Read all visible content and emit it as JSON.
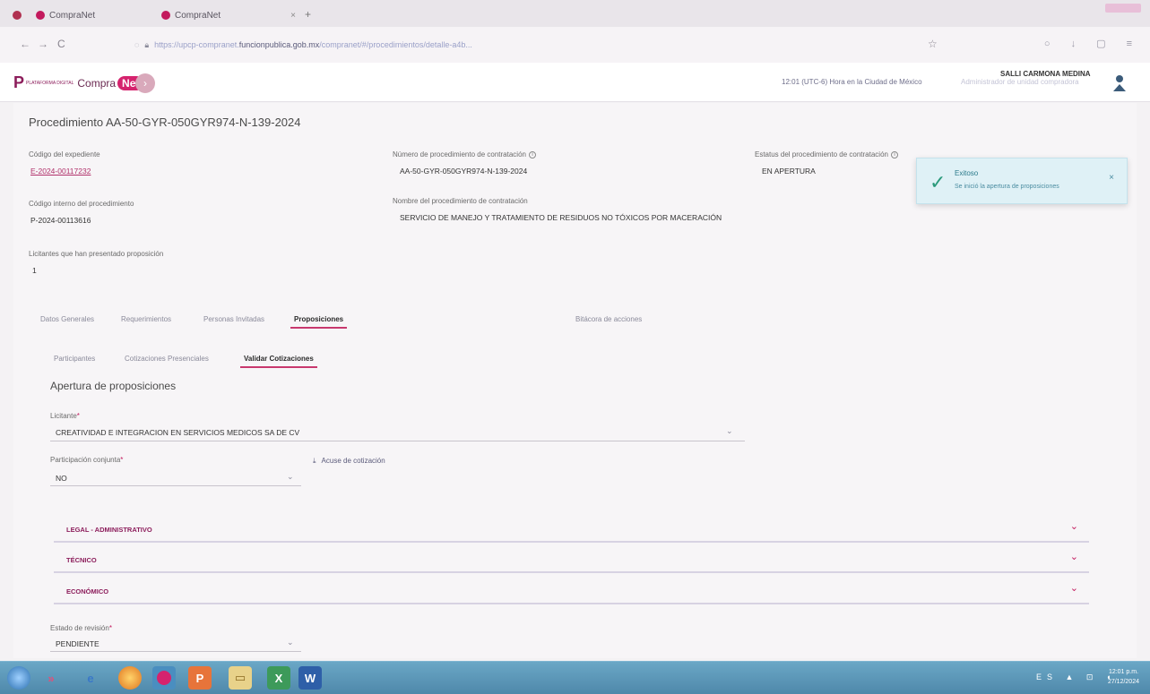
{
  "browser": {
    "tabs": [
      {
        "label": "CompraNet",
        "close": "×"
      },
      {
        "label": "CompraNet",
        "close": "×"
      }
    ],
    "new_tab": "+",
    "nav": {
      "back": "←",
      "forward": "→",
      "reload": "C"
    },
    "url_prefix": "https://upcp-compranet.",
    "url_host": "funcionpublica.gob.mx",
    "url_suffix": "/compranet/#/procedimientos/detalle-a4b..."
  },
  "app_header": {
    "logo_prefix": "P",
    "logo_small": "PLATAFORMA DIGITAL",
    "logo_text": "Compra",
    "logo_net": "Net",
    "menu_glyph": "›",
    "clock": "12:01 (UTC-6) Hora en la Ciudad de México",
    "role_hint": "Administrador de unidad compradora",
    "user_name": "SALLI CARMONA MEDINA"
  },
  "procedure": {
    "title": "Procedimiento AA-50-GYR-050GYR974-N-139-2024",
    "fields": {
      "codigo_expediente_label": "Código del expediente",
      "codigo_expediente_value": "E-2024-00117232",
      "numero_proc_label": "Número de procedimiento de contratación",
      "numero_proc_value": "AA-50-GYR-050GYR974-N-139-2024",
      "estatus_label": "Estatus del procedimiento de contratación",
      "estatus_value": "EN APERTURA",
      "codigo_interno_label": "Código interno del procedimiento",
      "codigo_interno_value": "P-2024-00113616",
      "nombre_proc_label": "Nombre del procedimiento de contratación",
      "nombre_proc_value": "SERVICIO DE MANEJO Y TRATAMIENTO DE RESIDUOS NO TÓXICOS POR MACERACIÓN",
      "licitantes_label": "Licitantes que han presentado proposición",
      "licitantes_value": "1"
    }
  },
  "toast": {
    "title": "Exitoso",
    "message": "Se inició la apertura de proposiciones",
    "close": "×"
  },
  "tabs": [
    "Datos Generales",
    "Requerimientos",
    "Personas Invitadas",
    "Proposiciones",
    "Bitácora de acciones"
  ],
  "active_tab": "Proposiciones",
  "subtabs": [
    "Participantes",
    "Cotizaciones Presenciales",
    "Validar Cotizaciones"
  ],
  "active_subtab": "Validar Cotizaciones",
  "apertura": {
    "title": "Apertura de proposiciones",
    "licitante_label": "Licitante",
    "licitante_value": "CREATIVIDAD E INTEGRACION EN SERVICIOS MEDICOS SA DE CV",
    "participacion_label": "Participación conjunta",
    "participacion_value": "NO",
    "acuse_label": "Acuse de cotización",
    "sections": [
      "LEGAL - ADMINISTRATIVO",
      "TÉCNICO",
      "ECONÓMICO"
    ],
    "estado_label": "Estado de revisión",
    "estado_value": "PENDIENTE",
    "required_mark": "*"
  },
  "taskbar": {
    "time": "12:01 p.m.",
    "date": "27/12/2024",
    "tray": "ES ▲ ⊡ ◖"
  },
  "colors": {
    "brand": "#c3195d",
    "toast_bg": "#dff1f6",
    "taskbar": "#5a93b5"
  }
}
